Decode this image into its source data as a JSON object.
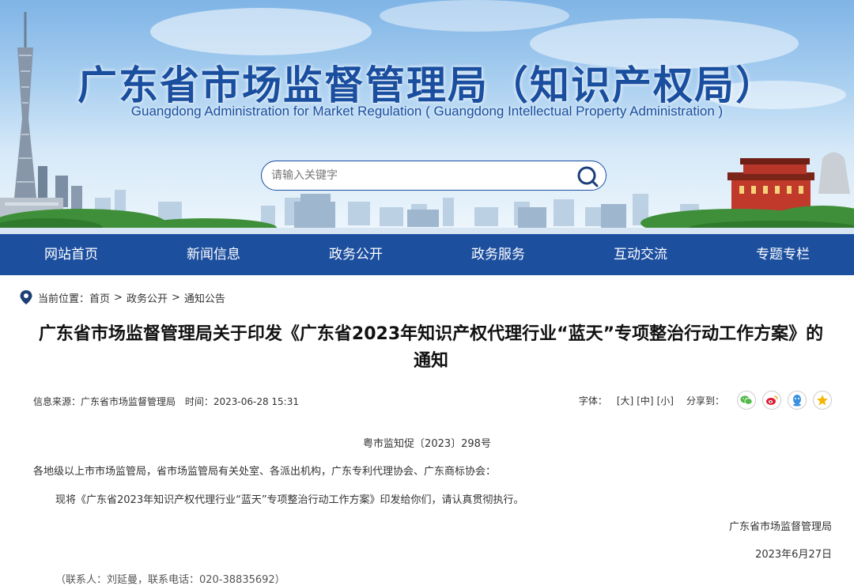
{
  "header": {
    "title": "广东省市场监督管理局（知识产权局）",
    "subtitle": "Guangdong Administration for Market Regulation ( Guangdong Intellectual Property Administration )",
    "search": {
      "placeholder": "请输入关键字",
      "icon": "search-icon"
    }
  },
  "nav": {
    "items": [
      {
        "label": "网站首页"
      },
      {
        "label": "新闻信息"
      },
      {
        "label": "政务公开"
      },
      {
        "label": "政务服务"
      },
      {
        "label": "互动交流"
      },
      {
        "label": "专题专栏"
      }
    ]
  },
  "breadcrumb": {
    "prefix": "当前位置：",
    "items": [
      "首页",
      "政务公开",
      "通知公告"
    ],
    "separator": ">"
  },
  "article": {
    "title": "广东省市场监督管理局关于印发《广东省2023年知识产权代理行业“蓝天”专项整治行动工作方案》的通知",
    "source": "信息来源：广东省市场监督管理局",
    "time": "时间：2023-06-28 15:31",
    "font_size_label": "字体：",
    "font_sizes": [
      "[大]",
      "[中]",
      "[小]"
    ],
    "share_label": "分享到：",
    "doc_number": "粤市监知促〔2023〕298号",
    "addressee": "各地级以上市市场监管局，省市场监管局有关处室、各派出机构，广东专利代理协会、广东商标协会：",
    "body": "现将《广东省2023年知识产权代理行业“蓝天”专项整治行动工作方案》印发给你们，请认真贯彻执行。",
    "signature": "广东省市场监督管理局",
    "date": "2023年6月27日",
    "contact": "（联系人：刘延曼，联系电话：020-38835692）"
  },
  "colors": {
    "brand_blue": "#1d4f9f",
    "wechat": "#52b94a",
    "weibo": "#e6162d",
    "qq": "#3a8fe0",
    "favorite": "#f5b400"
  }
}
